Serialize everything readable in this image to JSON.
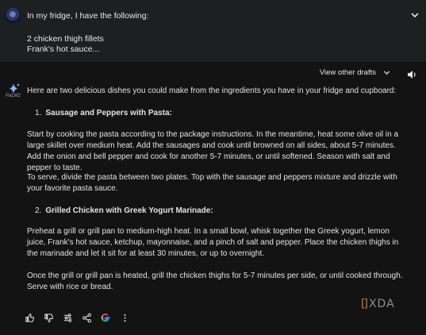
{
  "prompt": {
    "line1": "In my fridge, I have the following:",
    "line2": "2 chicken thigh fillets",
    "line3": "Frank's hot sauce..."
  },
  "response": {
    "view_drafts_label": "View other drafts",
    "model_label": "PaLM2",
    "intro": "Here are two delicious dishes you could make from the ingredients you have in your fridge and cupboard:",
    "dish1": {
      "number": "1.",
      "title": "Sausage and Peppers with Pasta:",
      "para1": "Start by cooking the pasta according to the package instructions. In the meantime, heat some olive oil in a large skillet over medium heat. Add the sausages and cook until browned on all sides, about 5-7 minutes. Add the onion and bell pepper and cook for another 5-7 minutes, or until softened. Season with salt and pepper to taste.",
      "para2": "To serve, divide the pasta between two plates. Top with the sausage and peppers mixture and drizzle with your favorite pasta sauce."
    },
    "dish2": {
      "number": "2.",
      "title": "Grilled Chicken with Greek Yogurt Marinade:",
      "para1": "Preheat a grill or grill pan to medium-high heat. In a small bowl, whisk together the Greek yogurt, lemon juice, Frank's hot sauce, ketchup, mayonnaise, and a pinch of salt and pepper. Place the chicken thighs in the marinade and let it sit for at least 30 minutes, or up to overnight.",
      "para2": "Once the grill or grill pan is heated, grill the chicken thighs for 5-7 minutes per side, or until cooked through. Serve with rice or bread."
    }
  },
  "actions": {
    "icons": [
      "thumbs-up-icon",
      "thumbs-down-icon",
      "tune-icon",
      "share-icon",
      "google-icon",
      "more-vert-icon"
    ]
  },
  "watermark": {
    "text": "XDA"
  },
  "colors": {
    "background": "#131314",
    "prompt_bg": "#1e1f20",
    "text": "#e3e3e3",
    "accent_blue": "#4285f4",
    "watermark_orange": "#d86a4b"
  }
}
